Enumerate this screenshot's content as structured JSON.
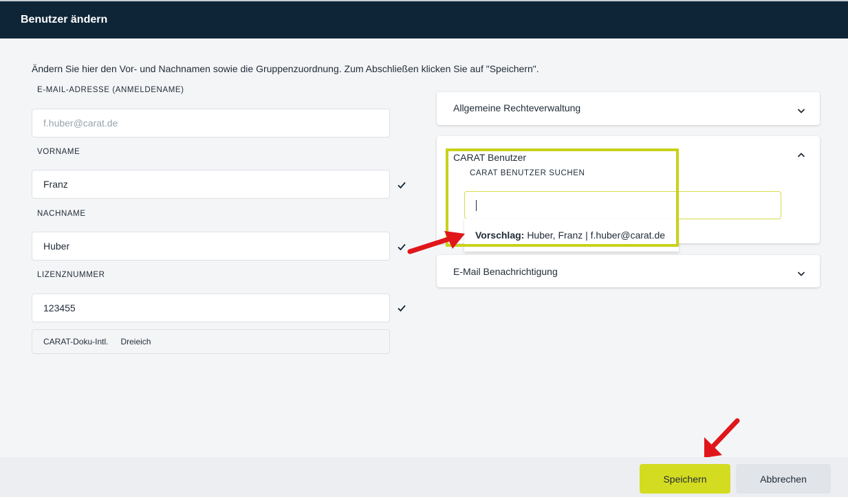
{
  "header": {
    "title": "Benutzer ändern"
  },
  "intro": "Ändern Sie hier den Vor- und Nachnamen sowie die Gruppenzuordnung. Zum Abschließen klicken Sie auf \"Speichern\".",
  "form": {
    "email": {
      "label": "E-MAIL-ADRESSE (ANMELDENAME)",
      "value": "f.huber@carat.de"
    },
    "firstname": {
      "label": "VORNAME",
      "value": "Franz"
    },
    "lastname": {
      "label": "NACHNAME",
      "value": "Huber"
    },
    "license": {
      "label": "LIZENZNUMMER",
      "value": "123455"
    },
    "group": {
      "name": "CARAT-Doku-Intl.",
      "location": "Dreieich"
    }
  },
  "panels": {
    "rights": {
      "title": "Allgemeine Rechteverwaltung",
      "icon": "chevron-down-icon"
    },
    "carat": {
      "title": "CARAT Benutzer",
      "icon": "chevron-up-icon",
      "search_label": "CARAT BENUTZER SUCHEN",
      "search_value": "",
      "suggestion_prefix": "Vorschlag:",
      "suggestion_text": "Huber, Franz | f.huber@carat.de"
    },
    "email_notify": {
      "title": "E-Mail Benachrichtigung",
      "icon": "chevron-down-icon"
    }
  },
  "footer": {
    "save_label": "Speichern",
    "cancel_label": "Abbrechen"
  },
  "colors": {
    "header_bg": "#0e2538",
    "accent": "#d4dc21",
    "highlight": "#c9d11a",
    "annotation_arrow": "#e0161b"
  }
}
